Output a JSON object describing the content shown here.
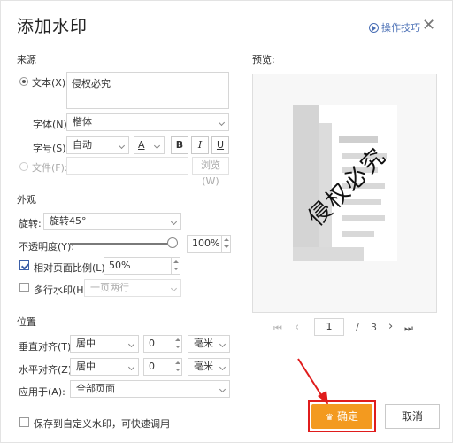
{
  "dialog": {
    "title": "添加水印",
    "help_label": "操作技巧",
    "close": "✕"
  },
  "source": {
    "section": "来源",
    "text_label": "文本(X):",
    "text_value": "侵权必究",
    "font_label": "字体(N):",
    "font_value": "楷体",
    "size_label": "字号(S):",
    "size_value": "自动",
    "color_letter": "A",
    "bold": "B",
    "italic": "I",
    "underline": "U",
    "file_label": "文件(F):",
    "browse": "浏览(W)"
  },
  "appearance": {
    "section": "外观",
    "rotate_label": "旋转:",
    "rotate_value": "旋转45°",
    "opacity_label": "不透明度(Y):",
    "opacity_value": "100%",
    "opacity_level": 1.0,
    "scale_label": "相对页面比例(L):",
    "scale_value": "50%",
    "multi_label": "多行水印(H):",
    "multi_value": "一页两行"
  },
  "position": {
    "section": "位置",
    "vertical_label": "垂直对齐(T):",
    "vertical_value": "居中",
    "vertical_offset": "0",
    "vertical_unit": "毫米",
    "horizontal_label": "水平对齐(Z):",
    "horizontal_value": "居中",
    "horizontal_offset": "0",
    "horizontal_unit": "毫米",
    "apply_label": "应用于(A):",
    "apply_value": "全部页面"
  },
  "save_custom_label": "保存到自定义水印，可快速调用",
  "preview": {
    "label": "预览:",
    "watermark_text": "侵权必究",
    "page_current": "1",
    "page_sep": "/",
    "page_total": "3",
    "first": "⏮",
    "prev": "‹",
    "next": "›",
    "last": "⏭"
  },
  "buttons": {
    "ok": "确定",
    "cancel": "取消"
  },
  "colors": {
    "accent": "#f39a1f",
    "highlight": "#e01c1c",
    "link": "#4a6fb5"
  }
}
